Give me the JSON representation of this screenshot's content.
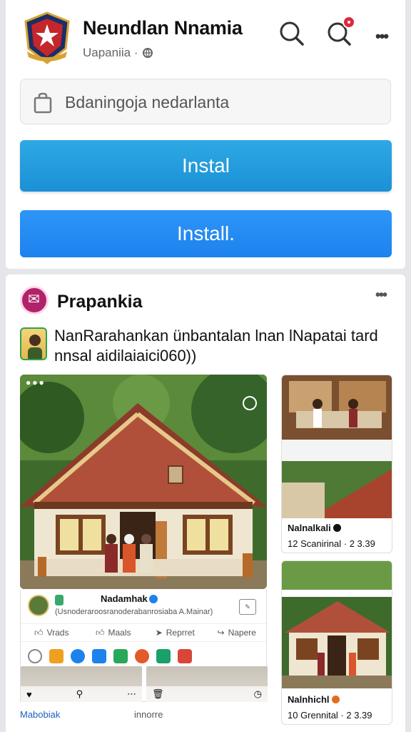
{
  "header": {
    "title": "Neundlan Nnamia",
    "subtitle": "Uapaniia ·",
    "icons": [
      "search-icon",
      "notification-icon",
      "more-icon"
    ]
  },
  "search": {
    "placeholder": "Bdaningoja nedarlanta"
  },
  "buttons": {
    "install_primary": "Instal",
    "install_secondary": "Install."
  },
  "post": {
    "page_name": "Prapankia",
    "text": "NanRarahankan ünbantalan lnan lNapatai tard nnsal aidilaiaici060))",
    "inner_card": {
      "badge": "",
      "name": "Nadamhak",
      "line": "(Usnoderaroosranoderabanrosiaba A.Mainar)",
      "actions": [
        "Vrads",
        "Maals",
        "Reprret",
        "Napere"
      ],
      "footer_left": "Mabobiak",
      "footer_mid": "innorre"
    },
    "side_tiles": [
      {
        "caption": "Nalnalkali",
        "sub": "12 Scanirinal · 2 3.39"
      },
      {
        "caption": "Nalnhichl",
        "sub": "10 Grennital · 2 3.39"
      }
    ]
  },
  "colors": {
    "install_primary": "#1b90d6",
    "install_secondary": "#1d82ee",
    "notification": "#e0283c",
    "page_icon": "#b0226a"
  }
}
